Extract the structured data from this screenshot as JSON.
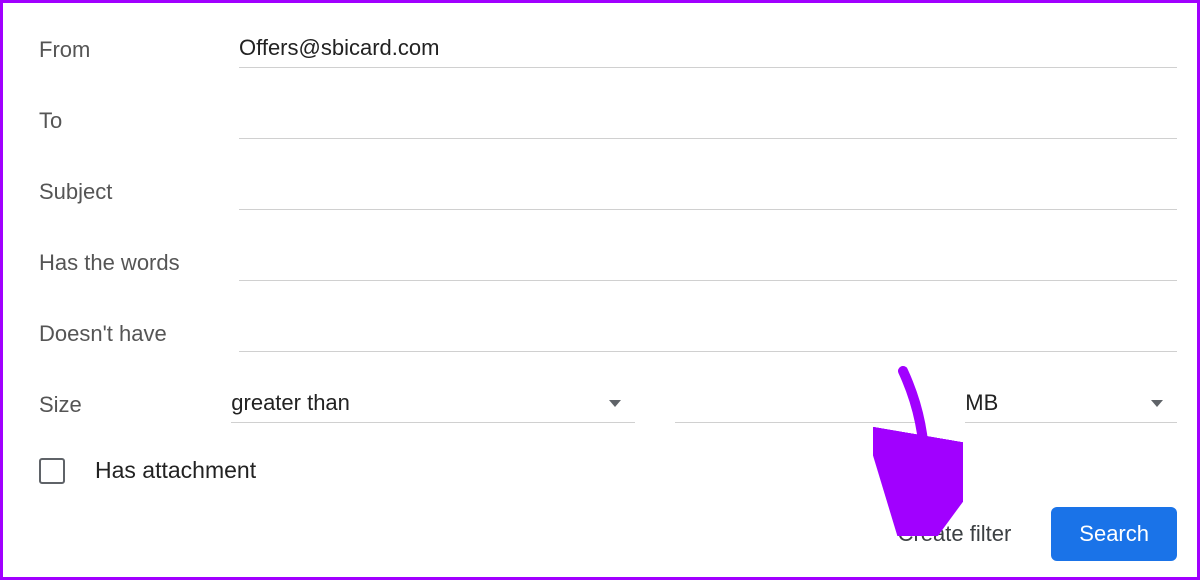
{
  "labels": {
    "from": "From",
    "to": "To",
    "subject": "Subject",
    "has_words": "Has the words",
    "doesnt_have": "Doesn't have",
    "size": "Size",
    "has_attachment": "Has attachment"
  },
  "values": {
    "from": "Offers@sbicard.com",
    "to": "",
    "subject": "",
    "has_words": "",
    "doesnt_have": "",
    "size_comparator": "greater than",
    "size_value": "",
    "size_unit": "MB",
    "has_attachment_checked": false
  },
  "buttons": {
    "create_filter": "Create filter",
    "search": "Search"
  },
  "colors": {
    "accent": "#1a73e8",
    "annotation": "#a100ff"
  }
}
